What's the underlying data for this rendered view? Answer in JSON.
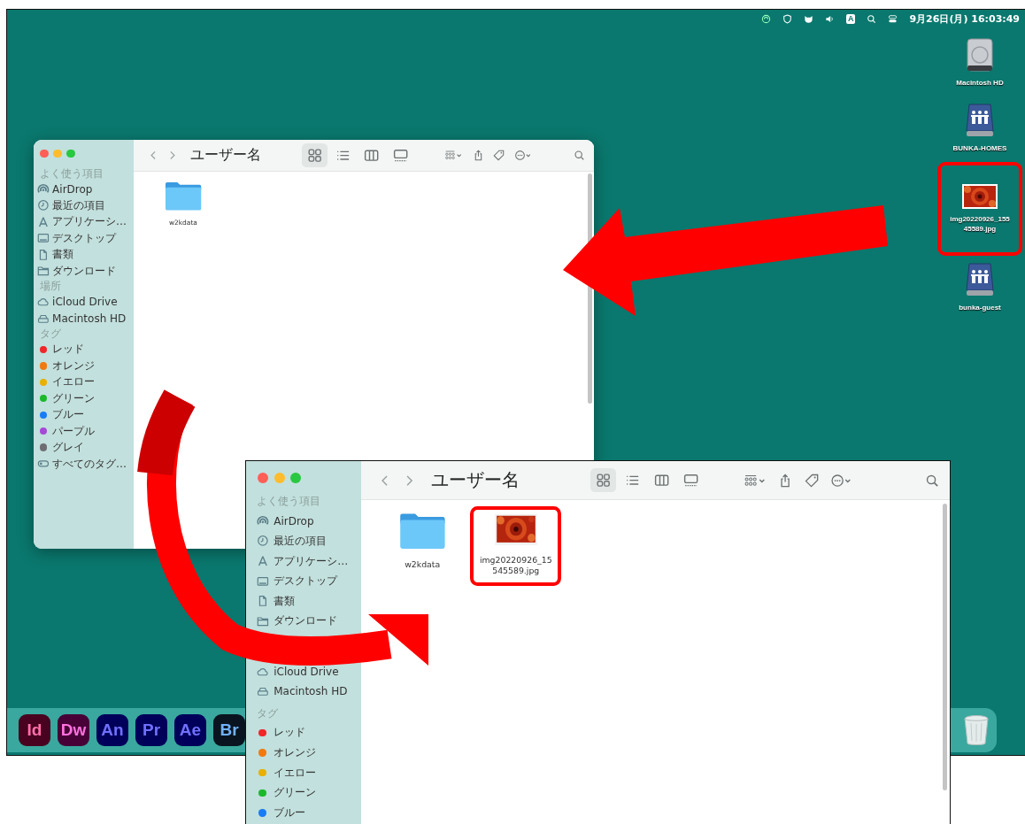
{
  "menu_bar": {
    "input_source": "A",
    "clock": "9月26日(月) 16:03:49"
  },
  "desktop_icons": [
    {
      "kind": "disk",
      "label_lines": [
        "Macintosh HD"
      ],
      "highlighted": false
    },
    {
      "kind": "server",
      "label_lines": [
        "BUNKA-HOMES"
      ],
      "highlighted": false
    },
    {
      "label_lines": [
        "img20220926_155",
        "45589.jpg"
      ],
      "highlighted": true
    },
    {
      "kind": "server",
      "label_lines": [
        "bunka-guest"
      ],
      "highlighted": false
    }
  ],
  "finder_windows": [
    {
      "title": "ユーザー名",
      "view_modes": [
        {
          "kind": "icons",
          "selected": true
        },
        {
          "kind": "list",
          "selected": false
        },
        {
          "kind": "columns",
          "selected": false
        },
        {
          "kind": "gallery",
          "selected": false
        }
      ],
      "sidebar": [
        {
          "heading": "よく使う項目",
          "items": [
            {
              "kind": "airdrop",
              "label": "AirDrop"
            },
            {
              "kind": "recent",
              "label": "最近の項目"
            },
            {
              "kind": "apps",
              "label": "アプリケーシ…"
            },
            {
              "kind": "desktop",
              "label": "デスクトップ"
            },
            {
              "kind": "document",
              "label": "書類"
            },
            {
              "kind": "downloads",
              "label": "ダウンロード"
            }
          ]
        },
        {
          "heading": "場所",
          "items": [
            {
              "kind": "icloud",
              "label": "iCloud Drive"
            },
            {
              "kind": "disk",
              "label": "Macintosh HD"
            }
          ]
        },
        {
          "heading": "タグ",
          "items": [
            {
              "kind": "tag",
              "label": "レッド",
              "color": "#f0262a"
            },
            {
              "kind": "tag",
              "label": "オレンジ",
              "color": "#f07a10"
            },
            {
              "kind": "tag",
              "label": "イエロー",
              "color": "#e8b000"
            },
            {
              "kind": "tag",
              "label": "グリーン",
              "color": "#1cb82c"
            },
            {
              "kind": "tag",
              "label": "ブルー",
              "color": "#1a7cf5"
            },
            {
              "kind": "tag",
              "label": "パープル",
              "color": "#a44ad6"
            },
            {
              "kind": "tag",
              "label": "グレイ",
              "color": "#6e6e72"
            },
            {
              "kind": "all_tags",
              "label": "すべてのタグ…"
            }
          ]
        }
      ],
      "files": [
        {
          "kind": "folder",
          "label_lines": [
            "w2kdata"
          ],
          "highlighted": false
        }
      ]
    },
    {
      "title": "ユーザー名",
      "view_modes": [
        {
          "kind": "icons",
          "selected": true
        },
        {
          "kind": "list",
          "selected": false
        },
        {
          "kind": "columns",
          "selected": false
        },
        {
          "kind": "gallery",
          "selected": false
        }
      ],
      "sidebar": [
        {
          "heading": "よく使う項目",
          "items": [
            {
              "kind": "airdrop",
              "label": "AirDrop"
            },
            {
              "kind": "recent",
              "label": "最近の項目"
            },
            {
              "kind": "apps",
              "label": "アプリケーシ…"
            },
            {
              "kind": "desktop",
              "label": "デスクトップ"
            },
            {
              "kind": "document",
              "label": "書類"
            },
            {
              "kind": "downloads",
              "label": "ダウンロード"
            }
          ]
        },
        {
          "items": [
            {
              "kind": "icloud",
              "label": "iCloud Drive"
            },
            {
              "kind": "disk",
              "label": "Macintosh HD"
            }
          ]
        },
        {
          "heading": "タグ",
          "items": [
            {
              "kind": "tag",
              "label": "レッド",
              "color": "#f0262a"
            },
            {
              "kind": "tag",
              "label": "オレンジ",
              "color": "#f07a10"
            },
            {
              "kind": "tag",
              "label": "イエロー",
              "color": "#e8b000"
            },
            {
              "kind": "tag",
              "label": "グリーン",
              "color": "#1cb82c"
            },
            {
              "kind": "tag",
              "label": "ブルー",
              "color": "#1a7cf5"
            }
          ]
        }
      ],
      "files": [
        {
          "kind": "folder",
          "label_lines": [
            "w2kdata"
          ],
          "highlighted": false
        },
        {
          "label_lines": [
            "img20220926_15",
            "545589.jpg"
          ],
          "highlighted": true
        }
      ]
    }
  ],
  "dock": {
    "apps": [
      {
        "label": "Id",
        "color": "#49021f"
      },
      {
        "label": "Dw",
        "color": "#470137"
      },
      {
        "label": "An",
        "color": "#00005b"
      },
      {
        "label": "Pr",
        "color": "#00005b"
      },
      {
        "label": "Ae",
        "color": "#00005b"
      },
      {
        "label": "Br",
        "color": "#0a1420"
      }
    ]
  }
}
